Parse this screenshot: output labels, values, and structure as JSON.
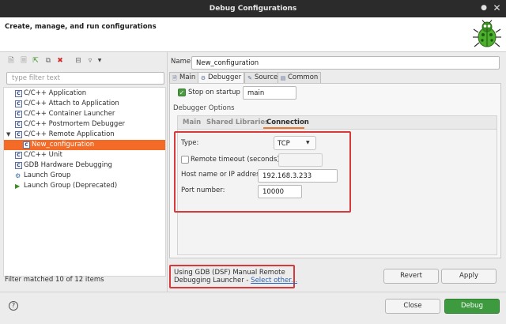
{
  "window": {
    "title": "Debug Configurations"
  },
  "header": {
    "title": "Create, manage, and run configurations"
  },
  "left": {
    "filter_placeholder": "type filter text",
    "tree": [
      {
        "label": "C/C++ Application",
        "icon": "c-file-icon"
      },
      {
        "label": "C/C++ Attach to Application",
        "icon": "c-file-icon"
      },
      {
        "label": "C/C++ Container Launcher",
        "icon": "c-file-icon"
      },
      {
        "label": "C/C++ Postmortem Debugger",
        "icon": "c-file-icon"
      },
      {
        "label": "C/C++ Remote Application",
        "icon": "c-file-icon",
        "expanded": true
      },
      {
        "label": "New_configuration",
        "icon": "c-file-icon",
        "selected": true
      },
      {
        "label": "C/C++ Unit",
        "icon": "c-file-icon"
      },
      {
        "label": "GDB Hardware Debugging",
        "icon": "c-file-icon"
      },
      {
        "label": "Launch Group",
        "icon": "launch-group-icon"
      },
      {
        "label": "Launch Group (Deprecated)",
        "icon": "launch-group-icon"
      }
    ],
    "status": "Filter matched 10 of 12 items"
  },
  "config": {
    "name_label": "Name:",
    "name_value": "New_configuration",
    "tabs": [
      "Main",
      "Debugger",
      "Source",
      "Common"
    ],
    "active_tab": "Debugger",
    "stop_on_startup_label": "Stop on startup at:",
    "stop_on_startup_checked": true,
    "stop_on_startup_value": "main",
    "debugger_options_label": "Debugger Options",
    "subtabs": [
      "Main",
      "Shared Libraries",
      "Connection"
    ],
    "active_subtab": "Connection",
    "connection": {
      "type_label": "Type:",
      "type_value": "TCP",
      "remote_timeout_label": "Remote timeout (seconds):",
      "remote_timeout_checked": false,
      "host_label": "Host name or IP address:",
      "host_value": "192.168.3.233",
      "port_label": "Port number:",
      "port_value": "10000"
    },
    "launcher_line1": "Using GDB (DSF) Manual Remote",
    "launcher_line2": "Debugging Launcher - ",
    "select_other": "Select other..."
  },
  "buttons": {
    "revert": "Revert",
    "apply": "Apply",
    "close": "Close",
    "debug": "Debug"
  },
  "colors": {
    "accent": "#f46b27",
    "debug_green": "#3d9a3f",
    "highlight_red": "#d63a3a"
  }
}
